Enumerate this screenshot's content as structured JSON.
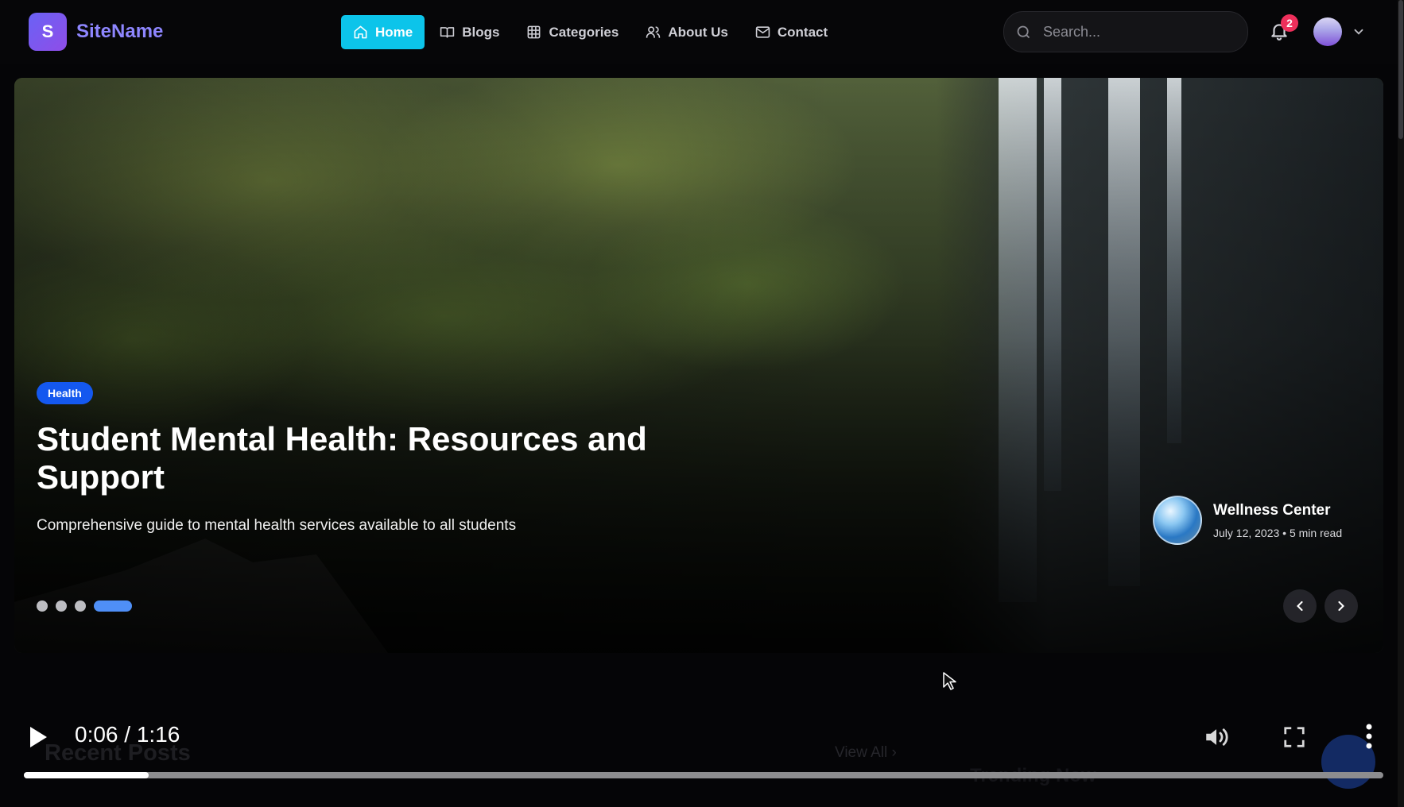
{
  "brand": {
    "logo_letter": "S",
    "name": "SiteName"
  },
  "nav": {
    "items": [
      {
        "label": "Home",
        "icon": "home-icon",
        "active": true
      },
      {
        "label": "Blogs",
        "icon": "book-icon",
        "active": false
      },
      {
        "label": "Categories",
        "icon": "grid-icon",
        "active": false
      },
      {
        "label": "About Us",
        "icon": "users-icon",
        "active": false
      },
      {
        "label": "Contact",
        "icon": "mail-icon",
        "active": false
      }
    ]
  },
  "search": {
    "placeholder": "Search...",
    "value": ""
  },
  "notifications": {
    "count": "2"
  },
  "hero": {
    "tag": "Health",
    "title": "Student Mental Health: Resources and Support",
    "subtitle": "Comprehensive guide to mental health services available to all students",
    "author": {
      "name": "Wellness Center",
      "meta": "July 12, 2023 • 5 min read"
    },
    "slides_total": 4,
    "active_slide": 4
  },
  "below_fold": {
    "section_title": "Recent Posts",
    "view_all": "View All ›",
    "trending": "Trending Now"
  },
  "player": {
    "time": "0:06 / 1:16",
    "progress_fraction": 0.092
  },
  "colors": {
    "accent_cyan": "#0cc4ea",
    "brand_purple": "#8e86ff",
    "tag_blue": "#1458ef",
    "badge_red": "#ee2f5b",
    "active_dot": "#4f8ff7"
  }
}
